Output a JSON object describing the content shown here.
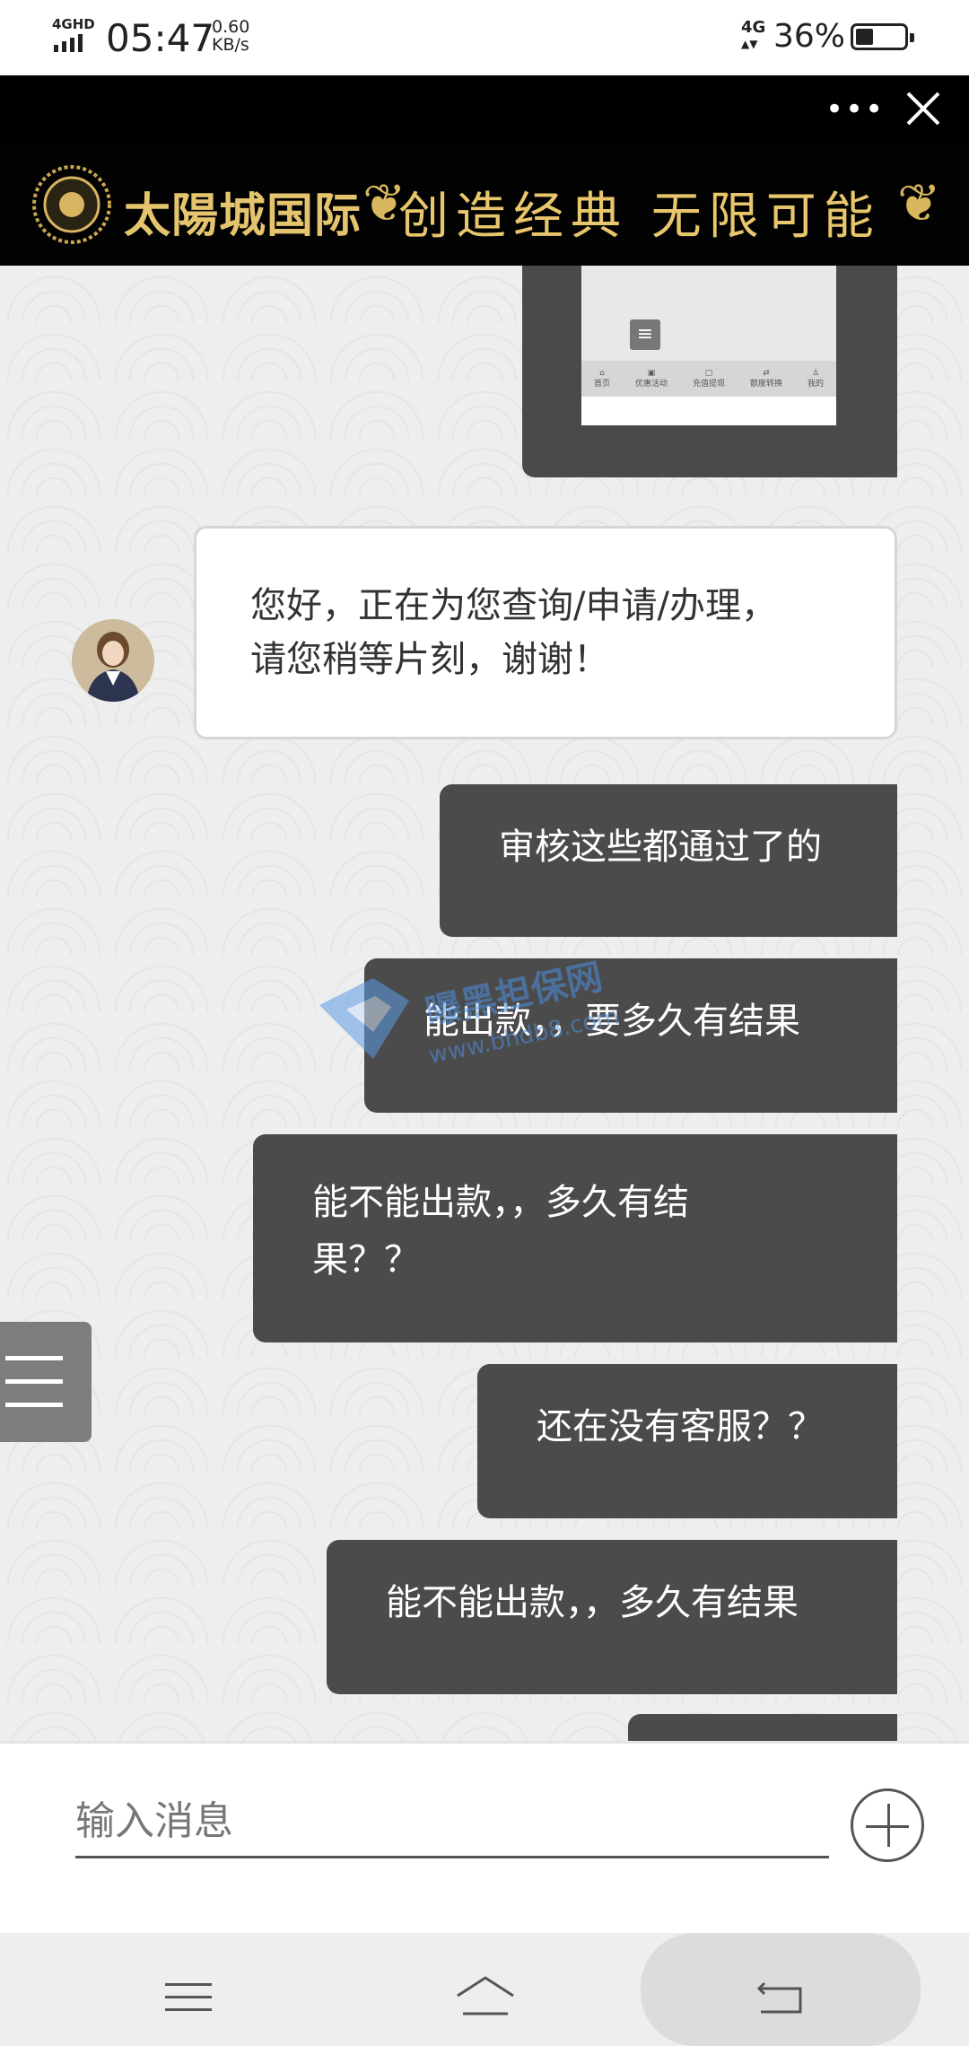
{
  "status_bar": {
    "network_type": "4GHD",
    "time": "05:47",
    "speed_value": "0.60",
    "speed_unit": "KB/s",
    "cell": "4G",
    "battery_percent": "36%",
    "battery_level": 0.36
  },
  "browser": {
    "more_label": "•••",
    "close_icon": "close-icon"
  },
  "banner": {
    "brand": "太陽城国际",
    "slogan": "创造经典  无限可能",
    "accent_color": "#e5c46e"
  },
  "preview": {
    "nav_items": [
      "首页",
      "优惠活动",
      "充值提现",
      "额度转换",
      "我的"
    ]
  },
  "messages": {
    "agent_line1": "您好，正在为您查询/申请/办理，",
    "agent_line2": "请您稍等片刻，谢谢！",
    "m1": "审核这些都通过了的",
    "m2": "能出款，，要多久有结果",
    "m3_line1": "能不能出款，，多久有结",
    "m3_line2": "果？？",
    "m4": "还在没有客服？？",
    "m5": "能不能出款，，多久有结果"
  },
  "watermark": {
    "text": "曝黑担保网",
    "url": "www.bhdb8.com"
  },
  "input": {
    "placeholder": "输入消息"
  },
  "colors": {
    "user_bubble": "#4b4b4b",
    "header_bg": "#000000"
  }
}
